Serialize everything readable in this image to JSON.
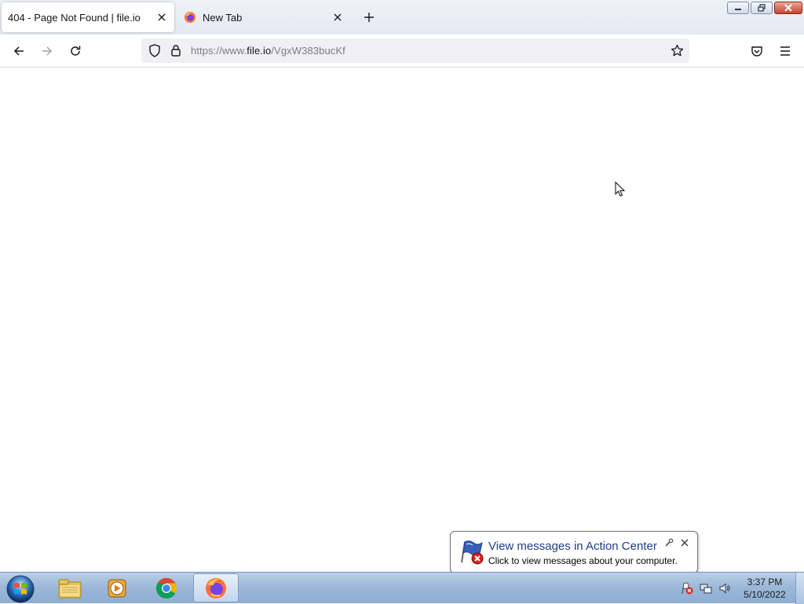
{
  "browser": {
    "tabs": [
      {
        "title": "404 - Page Not Found | file.io",
        "active": true,
        "favicon": "none"
      },
      {
        "title": "New Tab",
        "active": false,
        "favicon": "firefox-icon"
      }
    ],
    "url": {
      "prefix": "https://www.",
      "host": "file.io",
      "path": "/VgxW383bucKf"
    }
  },
  "notification": {
    "title": "View messages in Action Center",
    "body": "Click to view messages about your computer."
  },
  "taskbar": {
    "apps": [
      "windows-explorer",
      "windows-media-player",
      "google-chrome",
      "firefox"
    ],
    "active_app": "firefox",
    "clock": {
      "time": "3:37 PM",
      "date": "5/10/2022"
    }
  },
  "colors": {
    "notification_title": "#1e3d8c",
    "taskbar": "#9db9d9",
    "url_bar": "#f0f0f4"
  }
}
